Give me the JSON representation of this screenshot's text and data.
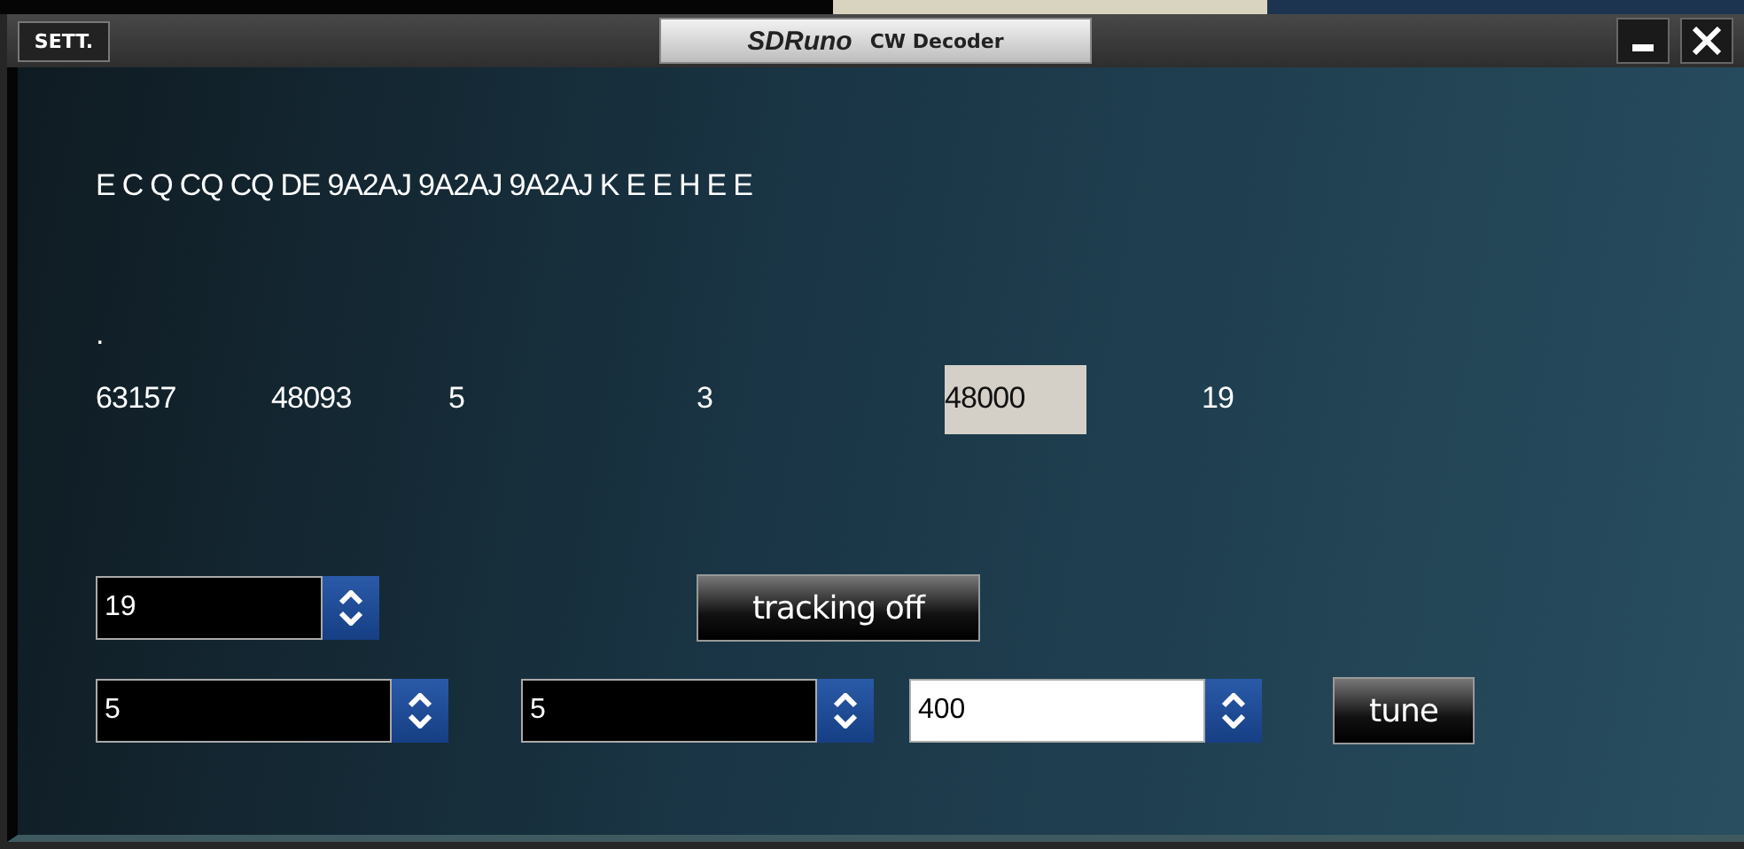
{
  "titlebar": {
    "settings_button": "SETT.",
    "logo": "SDRuno",
    "title": "CW Decoder"
  },
  "decoded_text": "E C Q CQ CQ DE 9A2AJ 9A2AJ 9A2AJ K E E H E E",
  "status_mark": ".",
  "readouts": [
    {
      "value": "63157",
      "highlighted": false
    },
    {
      "value": "48093",
      "highlighted": false
    },
    {
      "value": "5",
      "highlighted": false
    },
    {
      "value": "3",
      "highlighted": false
    },
    {
      "value": "48000",
      "highlighted": true
    },
    {
      "value": "19",
      "highlighted": false
    }
  ],
  "row1": {
    "spinner": {
      "value": "19",
      "kind": "dark"
    },
    "button": "tracking off"
  },
  "row2": {
    "spinners": [
      {
        "value": "5",
        "kind": "dark"
      },
      {
        "value": "5",
        "kind": "dark"
      },
      {
        "value": "400",
        "kind": "light"
      }
    ],
    "button": "tune"
  }
}
